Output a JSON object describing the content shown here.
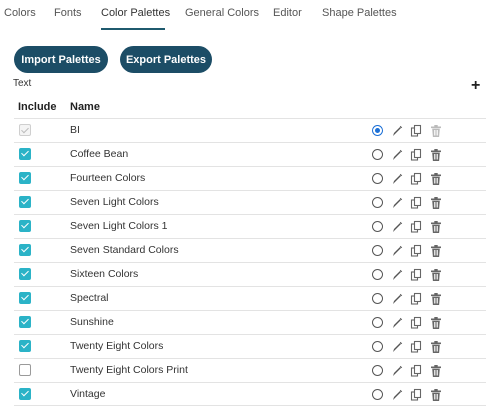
{
  "tabs": [
    {
      "label": "Colors",
      "active": false
    },
    {
      "label": "Fonts",
      "active": false
    },
    {
      "label": "Color Palettes",
      "active": true
    },
    {
      "label": "General Colors",
      "active": false
    },
    {
      "label": "Editor",
      "active": false
    },
    {
      "label": "Shape Palettes",
      "active": false
    }
  ],
  "buttons": {
    "import_label": "Import Palettes",
    "export_label": "Export Palettes"
  },
  "section_label": "Text",
  "add_icon": "plus-icon",
  "table": {
    "headers": {
      "include": "Include",
      "name": "Name"
    },
    "rows": [
      {
        "name": "BI",
        "include": "disabled-checked",
        "default": true
      },
      {
        "name": "Coffee Bean",
        "include": "checked",
        "default": false
      },
      {
        "name": "Fourteen Colors",
        "include": "checked",
        "default": false
      },
      {
        "name": "Seven Light Colors",
        "include": "checked",
        "default": false
      },
      {
        "name": "Seven Light Colors 1",
        "include": "checked",
        "default": false
      },
      {
        "name": "Seven Standard Colors",
        "include": "checked",
        "default": false
      },
      {
        "name": "Sixteen Colors",
        "include": "checked",
        "default": false
      },
      {
        "name": "Spectral",
        "include": "checked",
        "default": false
      },
      {
        "name": "Sunshine",
        "include": "checked",
        "default": false
      },
      {
        "name": "Twenty Eight Colors",
        "include": "checked",
        "default": false
      },
      {
        "name": "Twenty Eight Colors Print",
        "include": "unchecked",
        "default": false
      },
      {
        "name": "Vintage",
        "include": "checked",
        "default": false
      }
    ],
    "row_icons": [
      "default-radio",
      "edit-icon",
      "copy-icon",
      "delete-icon"
    ]
  },
  "colors": {
    "accent": "#1c4d66",
    "checkbox": "#2bb3c7",
    "radio": "#1b6fd6"
  }
}
